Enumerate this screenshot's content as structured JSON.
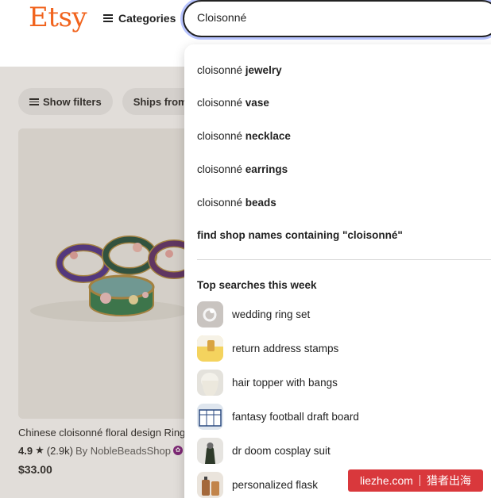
{
  "header": {
    "logo": "Etsy",
    "categories_label": "Categories",
    "search_value": "Cloisonné"
  },
  "filters": [
    {
      "label": "Show filters"
    },
    {
      "label": "Ships from US"
    }
  ],
  "listing": {
    "title": "Chinese cloisonné floral design Rings",
    "rating": "4.9",
    "reviews": "(2.9k)",
    "shop": "By NobleBeadsShop",
    "price": "$33.00"
  },
  "suggestions": [
    {
      "prefix": "cloisonné ",
      "suffix": "jewelry"
    },
    {
      "prefix": "cloisonné ",
      "suffix": "vase"
    },
    {
      "prefix": "cloisonné ",
      "suffix": "necklace"
    },
    {
      "prefix": "cloisonné ",
      "suffix": "earrings"
    },
    {
      "prefix": "cloisonné ",
      "suffix": "beads"
    }
  ],
  "shop_search": "find shop names containing \"cloisonné\"",
  "top_searches": {
    "title": "Top searches this week",
    "items": [
      {
        "label": "wedding ring set",
        "icon": "ring-photo"
      },
      {
        "label": "return address stamps",
        "icon": "stamp-photo"
      },
      {
        "label": "hair topper with bangs",
        "icon": "hair-photo"
      },
      {
        "label": "fantasy football draft board",
        "icon": "board-photo"
      },
      {
        "label": "dr doom cosplay suit",
        "icon": "costume-photo"
      },
      {
        "label": "personalized flask",
        "icon": "flask-photo"
      }
    ]
  },
  "watermark": {
    "left": "liezhe.com",
    "right": "猎者出海"
  },
  "colors": {
    "brand": "#f1641e",
    "focus_ring": "#4d6bfe",
    "watermark": "#d9383c"
  }
}
